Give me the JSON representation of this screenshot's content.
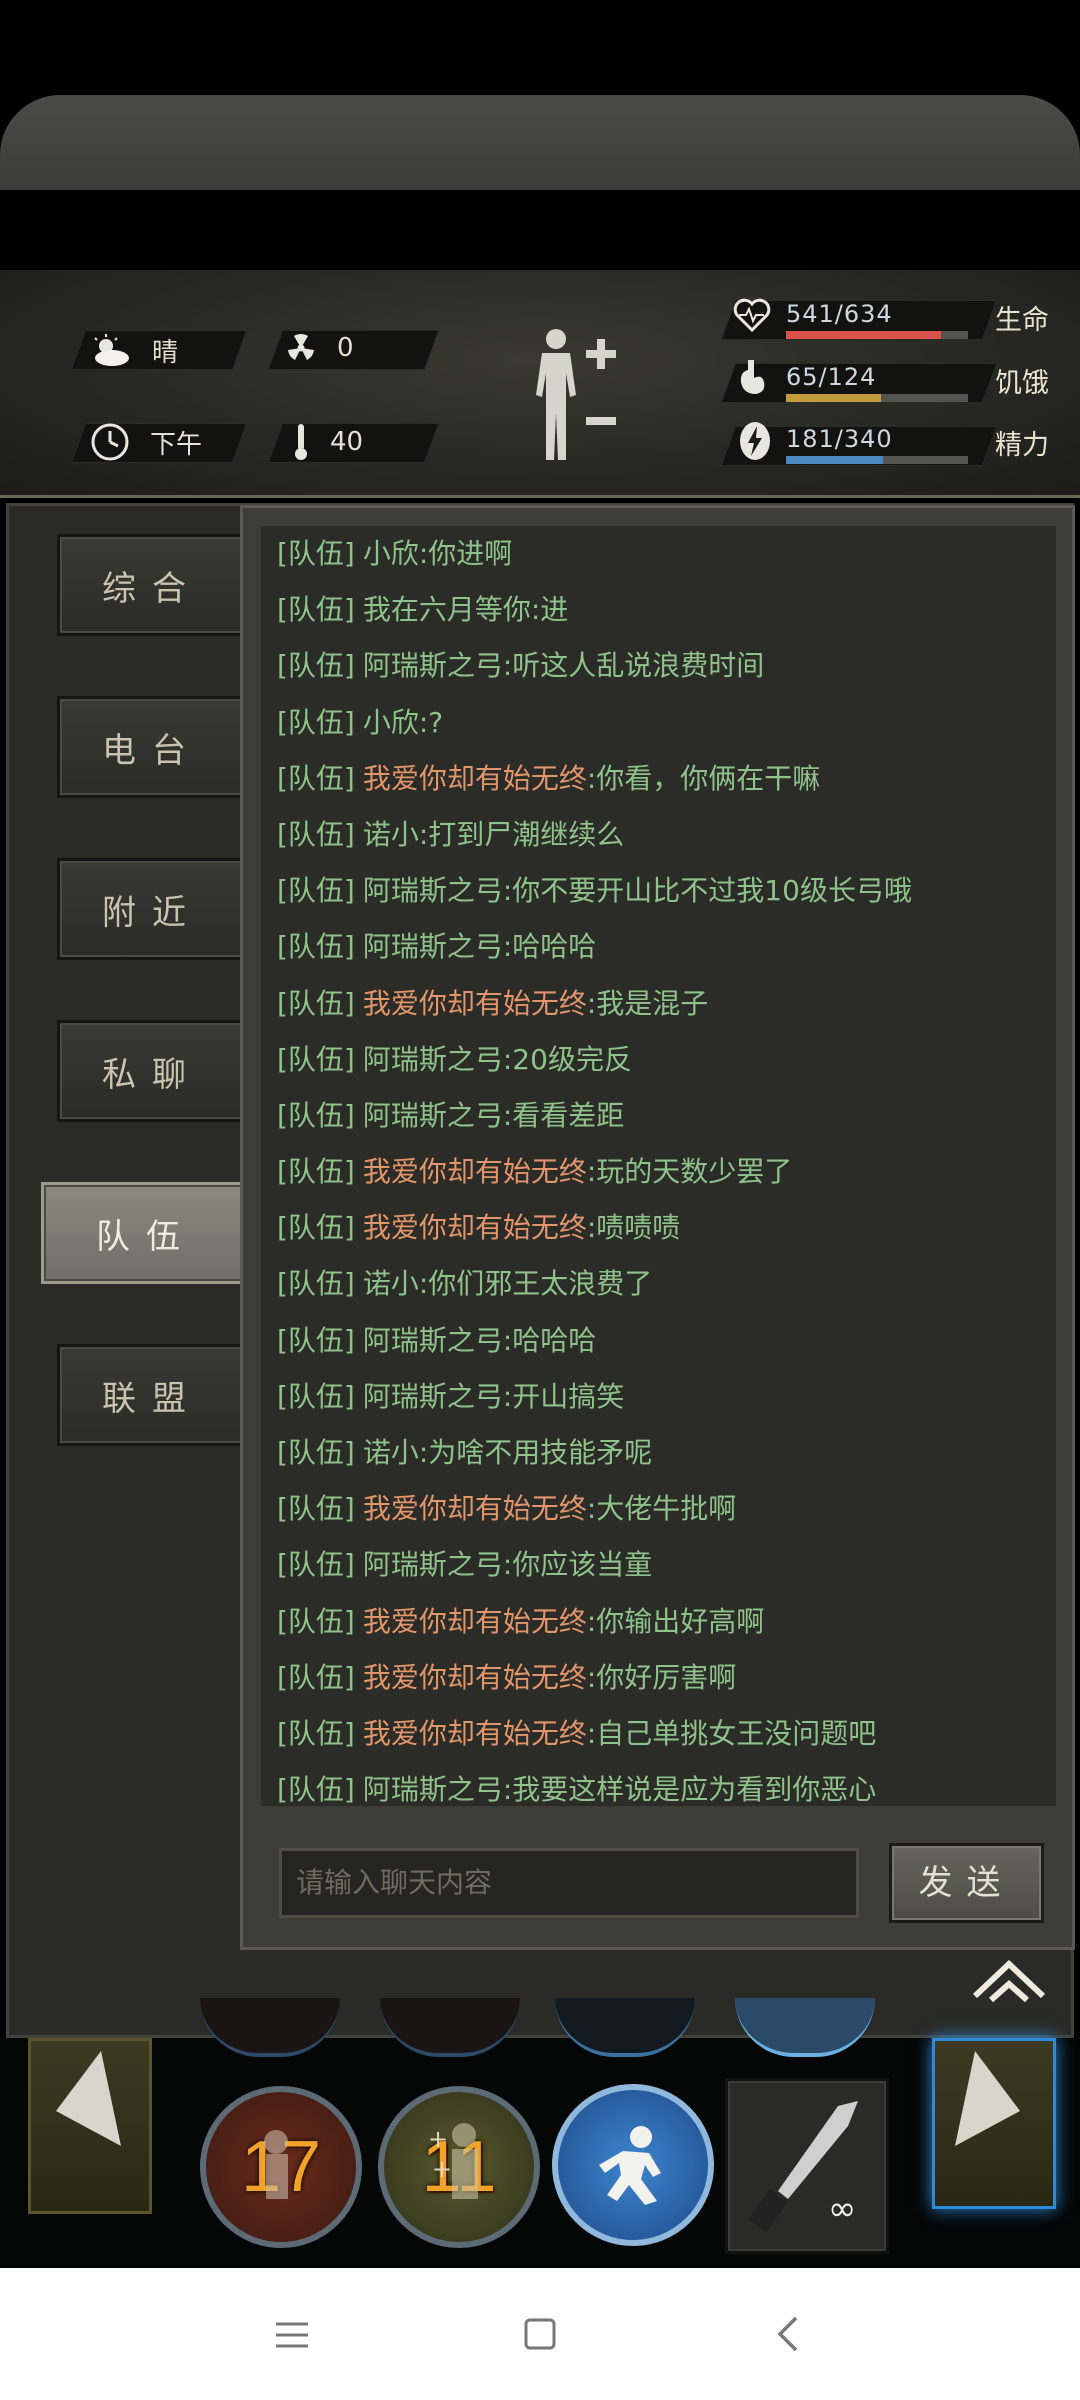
{
  "weather": {
    "label": "晴",
    "radiation": "0",
    "time": "下午",
    "temperature": "40"
  },
  "vitals": [
    {
      "name": "生命",
      "value": "541/634",
      "fraction": 0.853,
      "color": "#d9534a",
      "icon": "heart-pulse-icon"
    },
    {
      "name": "饥饿",
      "value": "65/124",
      "fraction": 0.524,
      "color": "#c49a3a",
      "icon": "stomach-icon"
    },
    {
      "name": "精力",
      "value": "181/340",
      "fraction": 0.532,
      "color": "#4a8ac0",
      "icon": "energy-bolt-icon"
    }
  ],
  "tabs": [
    "综合",
    "电台",
    "附近",
    "私聊",
    "队伍",
    "联盟"
  ],
  "active_tab": "队伍",
  "messages": [
    {
      "tag": "[队伍]",
      "name": "小欣",
      "text": ":你进啊",
      "highlight": false
    },
    {
      "tag": "[队伍]",
      "name": "我在六月等你",
      "text": ":进",
      "highlight": false
    },
    {
      "tag": "[队伍]",
      "name": "阿瑞斯之弓",
      "text": ":听这人乱说浪费时间",
      "highlight": false
    },
    {
      "tag": "[队伍]",
      "name": "小欣",
      "text": ":?",
      "highlight": false
    },
    {
      "tag": "[队伍]",
      "name": "我爱你却有始无终",
      "text": ":你看，你俩在干嘛",
      "highlight": true
    },
    {
      "tag": "[队伍]",
      "name": "诺小",
      "text": ":打到尸潮继续么",
      "highlight": false
    },
    {
      "tag": "[队伍]",
      "name": "阿瑞斯之弓",
      "text": ":你不要开山比不过我10级长弓哦",
      "highlight": false
    },
    {
      "tag": "[队伍]",
      "name": "阿瑞斯之弓",
      "text": ":哈哈哈",
      "highlight": false
    },
    {
      "tag": "[队伍]",
      "name": "我爱你却有始无终",
      "text": ":我是混子",
      "highlight": true
    },
    {
      "tag": "[队伍]",
      "name": "阿瑞斯之弓",
      "text": ":20级完反",
      "highlight": false
    },
    {
      "tag": "[队伍]",
      "name": "阿瑞斯之弓",
      "text": ":看看差距",
      "highlight": false
    },
    {
      "tag": "[队伍]",
      "name": "我爱你却有始无终",
      "text": ":玩的天数少罢了",
      "highlight": true
    },
    {
      "tag": "[队伍]",
      "name": "我爱你却有始无终",
      "text": ":啧啧啧",
      "highlight": true
    },
    {
      "tag": "[队伍]",
      "name": "诺小",
      "text": ":你们邪王太浪费了",
      "highlight": false
    },
    {
      "tag": "[队伍]",
      "name": "阿瑞斯之弓",
      "text": ":哈哈哈",
      "highlight": false
    },
    {
      "tag": "[队伍]",
      "name": "阿瑞斯之弓",
      "text": ":开山搞笑",
      "highlight": false
    },
    {
      "tag": "[队伍]",
      "name": "诺小",
      "text": ":为啥不用技能矛呢",
      "highlight": false
    },
    {
      "tag": "[队伍]",
      "name": "我爱你却有始无终",
      "text": ":大佬牛批啊",
      "highlight": true
    },
    {
      "tag": "[队伍]",
      "name": "阿瑞斯之弓",
      "text": ":你应该当童",
      "highlight": false
    },
    {
      "tag": "[队伍]",
      "name": "我爱你却有始无终",
      "text": ":你输出好高啊",
      "highlight": true
    },
    {
      "tag": "[队伍]",
      "name": "我爱你却有始无终",
      "text": ":你好厉害啊",
      "highlight": true
    },
    {
      "tag": "[队伍]",
      "name": "我爱你却有始无终",
      "text": ":自己单挑女王没问题吧",
      "highlight": true
    },
    {
      "tag": "[队伍]",
      "name": "阿瑞斯之弓",
      "text": ":我要这样说是应为看到你恶心",
      "highlight": false
    }
  ],
  "chat_input": {
    "placeholder": "请输入聊天内容"
  },
  "send_label": "发送",
  "skills": [
    {
      "count": "17",
      "icon": "wrecker-skill-icon"
    },
    {
      "count": "11",
      "icon": "heal-skill-icon"
    },
    {
      "count": "",
      "icon": "crouch-skill-icon"
    }
  ],
  "weapon": {
    "durability": "∞",
    "icon": "knife-icon"
  },
  "colors": {
    "highlight_name": "#e0956a",
    "chat_text": "#8fc28a",
    "health": "#d9534a",
    "hunger": "#c49a3a",
    "energy": "#4a8ac0"
  }
}
